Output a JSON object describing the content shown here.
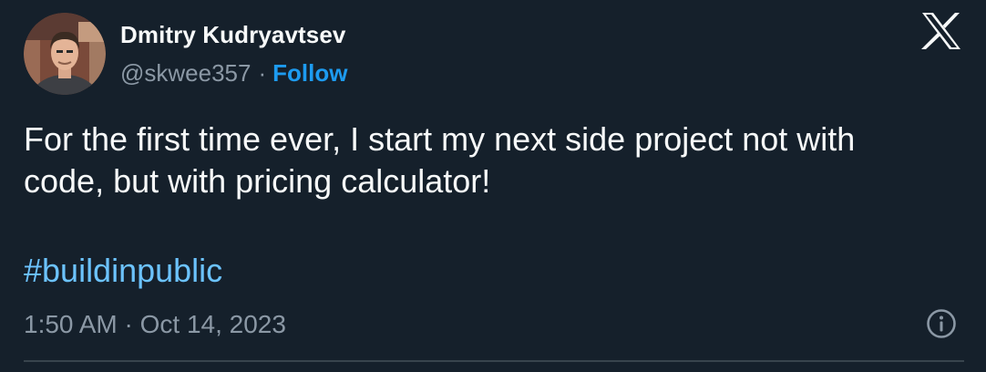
{
  "author": {
    "display_name": "Dmitry Kudryavtsev",
    "handle": "@skwee357",
    "separator": "·",
    "follow_label": "Follow"
  },
  "tweet": {
    "text": "For the first time ever, I start my next side project not with\ncode, but with pricing calculator!",
    "hashtag": "#buildinpublic",
    "timestamp": "1:50 AM · Oct 14, 2023"
  },
  "icons": {
    "brand": "x-logo-icon",
    "info": "info-icon"
  },
  "colors": {
    "background": "#15202b",
    "text_primary": "#f7f9f9",
    "text_secondary": "#8b98a5",
    "accent": "#1d9bf0",
    "hashtag": "#6cc3ff",
    "divider": "#38444d"
  }
}
